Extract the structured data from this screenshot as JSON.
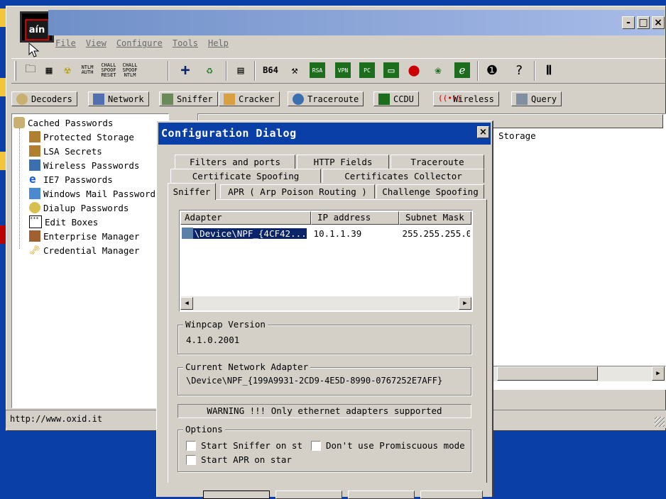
{
  "window": {
    "app_icon_text": "aín",
    "controls": [
      "-",
      "□",
      "×"
    ]
  },
  "menu": [
    "File",
    "View",
    "Configure",
    "Tools",
    "Help"
  ],
  "toolbar": {
    "icons": [
      "open-icon",
      "network-card-icon",
      "radiation-icon",
      "ntlm-auth-icon",
      "chall-spoof-reset-icon",
      "chall-spoof-ntlm-icon",
      "add-icon",
      "recycle-icon",
      "export-icon",
      "base64-icon",
      "tool-icon",
      "rsa-icon",
      "vpn-icon",
      "pc-icon",
      "terminal-icon",
      "record-icon",
      "globe-icon",
      "wallet-icon",
      "info-icon",
      "help-icon",
      "exit-icon"
    ],
    "labels": {
      "ntlm_auth": "NTLM AUTH",
      "chall_spoof_reset": "CHALL SPOOF RESET",
      "chall_spoof_ntlm": "CHALL SPOOF NTLM",
      "base64": "B64"
    }
  },
  "tabs": [
    "Decoders",
    "Network",
    "Sniffer",
    "Cracker",
    "Traceroute",
    "CCDU",
    "Wireless",
    "Query"
  ],
  "tree": {
    "root": "Cached Passwords",
    "items": [
      "Protected Storage",
      "LSA Secrets",
      "Wireless Passwords",
      "IE7 Passwords",
      "Windows Mail Passwords",
      "Dialup Passwords",
      "Edit Boxes",
      "Enterprise Manager",
      "Credential Manager"
    ]
  },
  "right_pane": {
    "header": "Storage"
  },
  "status_bar": {
    "url": "http://www.oxid.it"
  },
  "dialog": {
    "title": "Configuration Dialog",
    "close": "×",
    "tabs_row1": [
      "Filters and ports",
      "HTTP Fields",
      "Traceroute"
    ],
    "tabs_row2": [
      "Certificate Spoofing",
      "Certificates Collector"
    ],
    "tabs_row3": [
      "Sniffer",
      "APR ( Arp Poison Routing )",
      "Challenge Spoofing"
    ],
    "adapter_table": {
      "columns": [
        "Adapter",
        "IP address",
        "Subnet Mask"
      ],
      "rows": [
        {
          "adapter": "\\Device\\NPF_{4CF42...",
          "ip": "10.1.1.39",
          "mask": "255.255.255.0"
        }
      ]
    },
    "winpcap": {
      "title": "Winpcap Version",
      "value": "4.1.0.2001"
    },
    "current_adapter": {
      "title": "Current Network Adapter",
      "value": "\\Device\\NPF_{199A9931-2CD9-4E5D-8990-0767252E7AFF}"
    },
    "warning": "WARNING !!! Only ethernet adapters supported",
    "options": {
      "title": "Options",
      "start_sniffer": "Start Sniffer on st",
      "dont_promisc": "Don't use Promiscuous mode",
      "start_apr": "Start APR on star"
    }
  },
  "colors": {
    "desktop": "#0b3fa8",
    "title_active": "#0b3fa8",
    "face": "#d4d0c8",
    "selection": "#0a246a"
  }
}
